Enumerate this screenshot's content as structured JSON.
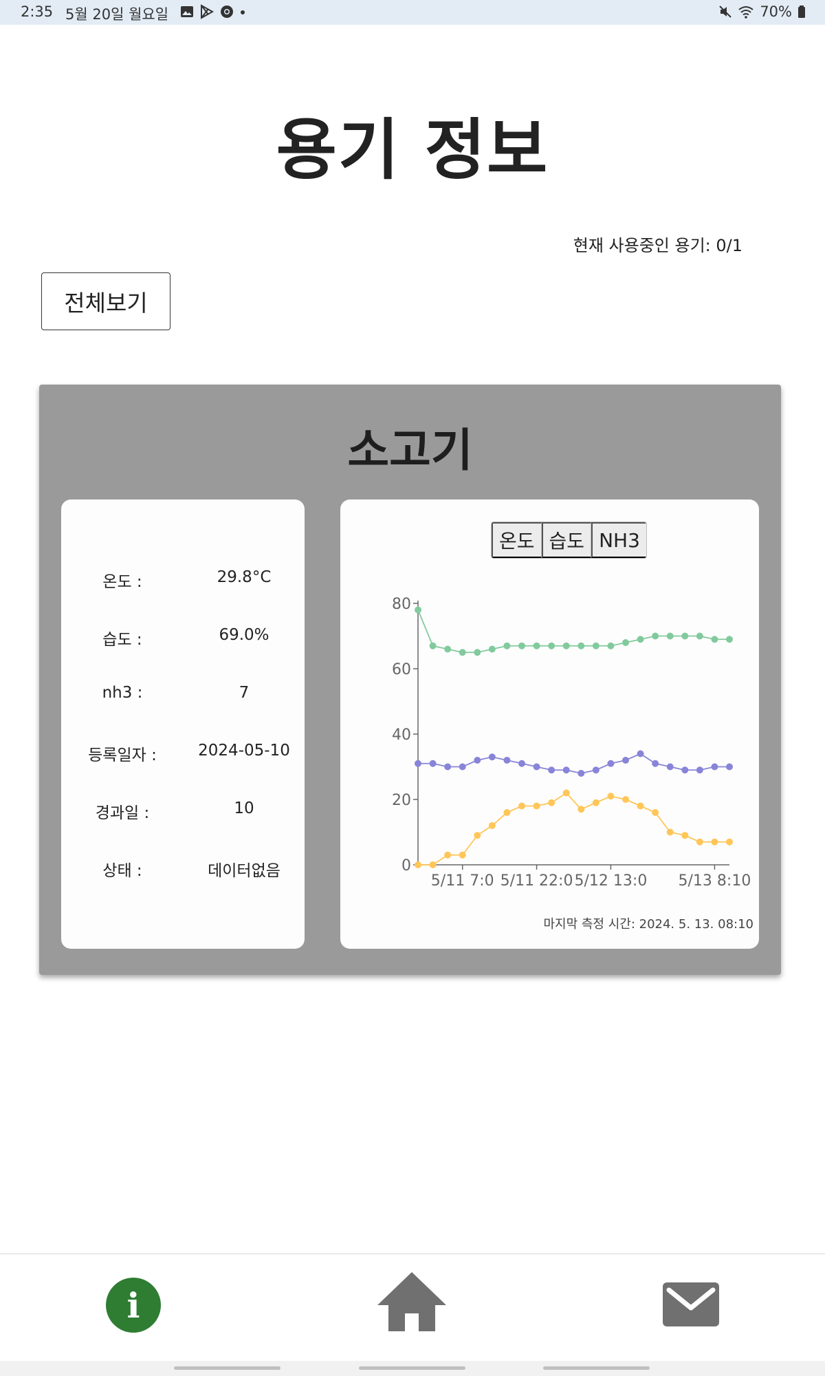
{
  "status_bar": {
    "time": "2:35",
    "date": "5월 20일 월요일",
    "battery": "70%"
  },
  "page": {
    "title": "용기 정보",
    "usage_text": "현재 사용중인 용기: 0/1",
    "view_all_label": "전체보기"
  },
  "container_card": {
    "title": "소고기",
    "info": [
      {
        "label": "온도 :",
        "value": "29.8°C"
      },
      {
        "label": "습도 :",
        "value": "69.0%"
      },
      {
        "label": "nh3 :",
        "value": "7"
      },
      {
        "label": "등록일자 :",
        "value": "2024-05-10"
      },
      {
        "label": "경과일 :",
        "value": "10"
      },
      {
        "label": "상태 :",
        "value": "데이터없음"
      }
    ],
    "tabs": [
      "온도",
      "습도",
      "NH3"
    ],
    "last_measure": "마지막 측정 시간: 2024. 5. 13. 08:10"
  },
  "colors": {
    "green_series": "#82ca9d",
    "purple_series": "#8884d8",
    "yellow_series": "#ffc658",
    "card_bg": "#9a9a9a",
    "info_button": "#2e7d32",
    "nav_icon": "#707070"
  },
  "nav": {
    "icons": [
      "info-icon",
      "home-icon",
      "mail-icon"
    ]
  },
  "chart_data": {
    "type": "line",
    "title": "",
    "xlabel": "",
    "ylabel": "",
    "ylim": [
      0,
      80
    ],
    "yticks": [
      0,
      20,
      40,
      60,
      80
    ],
    "xtick_labels": [
      "5/11 7:0",
      "5/11 22:0",
      "5/12 13:0",
      "5/13 8:10"
    ],
    "xtick_indices": [
      3,
      8,
      13,
      20
    ],
    "series": [
      {
        "color": "#82ca9d",
        "values": [
          78,
          67,
          66,
          65,
          65,
          66,
          67,
          67,
          67,
          67,
          67,
          67,
          67,
          67,
          68,
          69,
          70,
          70,
          70,
          70,
          69,
          69
        ]
      },
      {
        "color": "#8884d8",
        "values": [
          31,
          31,
          30,
          30,
          32,
          33,
          32,
          31,
          30,
          29,
          29,
          28,
          29,
          31,
          32,
          34,
          31,
          30,
          29,
          29,
          30,
          30
        ]
      },
      {
        "color": "#ffc658",
        "values": [
          0,
          0,
          3,
          3,
          9,
          12,
          16,
          18,
          18,
          19,
          22,
          17,
          19,
          21,
          20,
          18,
          16,
          10,
          9,
          7,
          7,
          7
        ]
      }
    ]
  }
}
